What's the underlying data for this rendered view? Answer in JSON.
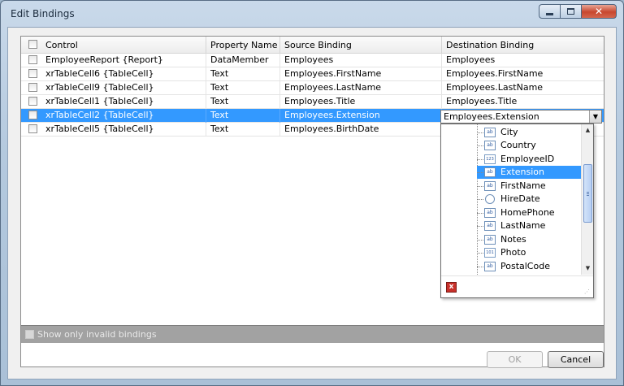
{
  "window": {
    "title": "Edit Bindings"
  },
  "grid": {
    "columns": [
      "Control",
      "Property Name",
      "Source Binding",
      "Destination Binding"
    ],
    "rows": [
      {
        "control": "EmployeeReport {Report}",
        "property": "DataMember",
        "source": "Employees",
        "destination": "Employees"
      },
      {
        "control": "xrTableCell6 {TableCell}",
        "property": "Text",
        "source": "Employees.FirstName",
        "destination": "Employees.FirstName"
      },
      {
        "control": "xrTableCell9 {TableCell}",
        "property": "Text",
        "source": "Employees.LastName",
        "destination": "Employees.LastName"
      },
      {
        "control": "xrTableCell1 {TableCell}",
        "property": "Text",
        "source": "Employees.Title",
        "destination": "Employees.Title"
      },
      {
        "control": "xrTableCell2 {TableCell}",
        "property": "Text",
        "source": "Employees.Extension",
        "destination": ""
      },
      {
        "control": "xrTableCell5 {TableCell}",
        "property": "Text",
        "source": "Employees.BirthDate",
        "destination": ""
      }
    ],
    "selected_row_index": 4
  },
  "dropdown": {
    "value": "Employees.Extension",
    "items": [
      {
        "label": "City",
        "icon": "ab"
      },
      {
        "label": "Country",
        "icon": "ab"
      },
      {
        "label": "EmployeeID",
        "icon": "123"
      },
      {
        "label": "Extension",
        "icon": "ab"
      },
      {
        "label": "FirstName",
        "icon": "ab"
      },
      {
        "label": "HireDate",
        "icon": "date"
      },
      {
        "label": "HomePhone",
        "icon": "ab"
      },
      {
        "label": "LastName",
        "icon": "ab"
      },
      {
        "label": "Notes",
        "icon": "ab"
      },
      {
        "label": "Photo",
        "icon": "101"
      },
      {
        "label": "PostalCode",
        "icon": "ab"
      }
    ],
    "highlighted_item": "Extension",
    "scroll_arrow_up": "▲",
    "scroll_arrow_down": "▼",
    "clear_glyph": "x",
    "grip_glyph": "⋰"
  },
  "footer": {
    "show_invalid_label": "Show only invalid bindings"
  },
  "buttons": {
    "ok": "OK",
    "cancel": "Cancel"
  },
  "icons": {
    "icon_ab": "ab",
    "icon_num": "123",
    "icon_bin": "101",
    "close_glyph": "✕",
    "combo_arrow": "▼"
  },
  "colors": {
    "selection": "#3399ff",
    "close_button": "#c8472e"
  }
}
